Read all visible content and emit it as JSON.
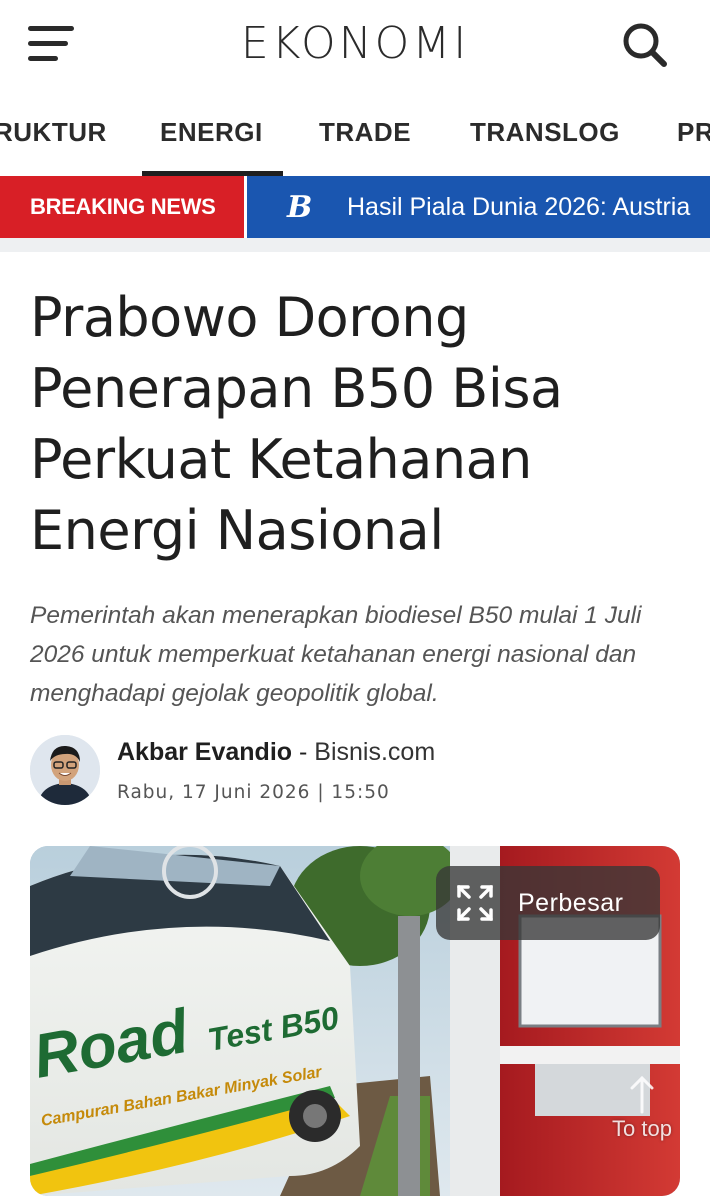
{
  "header": {
    "brand": "EKONOMI",
    "menu_icon": "hamburger-menu-icon",
    "search_icon": "search-icon"
  },
  "categories": [
    {
      "label": "RUKTUR",
      "active": false
    },
    {
      "label": "ENERGI",
      "active": true
    },
    {
      "label": "TRADE",
      "active": false
    },
    {
      "label": "TRANSLOG",
      "active": false
    },
    {
      "label": "PR",
      "active": false
    }
  ],
  "breaking": {
    "label": "BREAKING NEWS",
    "logo": "B",
    "headline": "Hasil Piala Dunia 2026: Austria",
    "label_color": "#d81f26",
    "ticker_color": "#1a56b0"
  },
  "article": {
    "title": "Prabowo Dorong Penerapan B50 Bisa Perkuat Ketahanan Energi Nasional",
    "summary": "Pemerintah akan menerapkan biodiesel B50 mulai 1 Juli 2026 untuk memperkuat ketahanan energi nasional dan menghadapi gejolak geopolitik global.",
    "author": "Akbar Evandio",
    "separator": " - ",
    "source": "Bisnis.com",
    "date": "Rabu, 17 Juni 2026 | 15:50"
  },
  "image": {
    "bus_text": "Road Test B50",
    "bus_subtext": "Campuran Bahan Bakar Minyak Solar Dengan Biodiesel",
    "zoom_label": "Perbesar",
    "zoom_icon": "expand-icon",
    "to_top_label": "To top",
    "to_top_icon": "arrow-up-icon"
  }
}
